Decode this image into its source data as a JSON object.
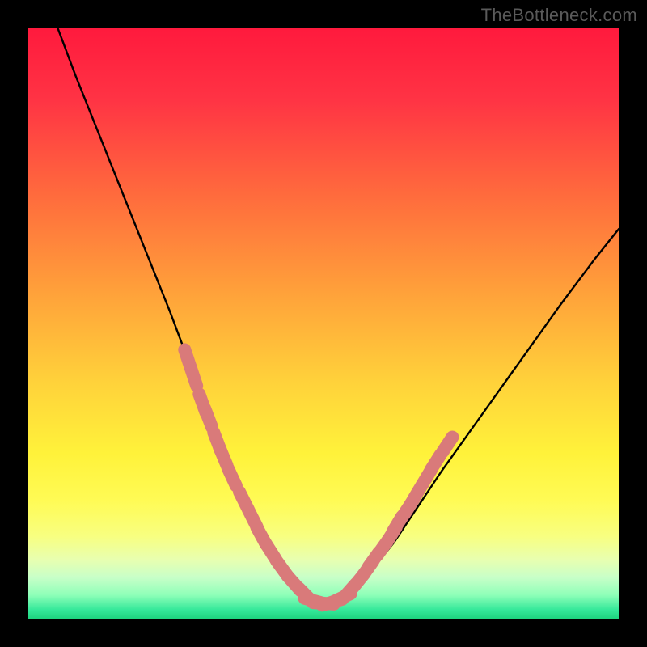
{
  "watermark": "TheBottleneck.com",
  "colors": {
    "frame_bg": "#000000",
    "curve_stroke": "#000000",
    "bead_fill": "#d97a7a",
    "gradient_stops": [
      {
        "offset": 0.0,
        "color": "#ff1a3d"
      },
      {
        "offset": 0.12,
        "color": "#ff3344"
      },
      {
        "offset": 0.28,
        "color": "#ff6a3d"
      },
      {
        "offset": 0.45,
        "color": "#ffa23a"
      },
      {
        "offset": 0.6,
        "color": "#ffd23a"
      },
      {
        "offset": 0.72,
        "color": "#fff23a"
      },
      {
        "offset": 0.8,
        "color": "#fffb55"
      },
      {
        "offset": 0.86,
        "color": "#f8ff80"
      },
      {
        "offset": 0.9,
        "color": "#e8ffb0"
      },
      {
        "offset": 0.93,
        "color": "#c8ffc8"
      },
      {
        "offset": 0.96,
        "color": "#8effb8"
      },
      {
        "offset": 0.985,
        "color": "#35e89a"
      },
      {
        "offset": 1.0,
        "color": "#1ed47f"
      }
    ]
  },
  "chart_data": {
    "type": "line",
    "title": "",
    "xlabel": "",
    "ylabel": "",
    "xlim": [
      0,
      100
    ],
    "ylim": [
      0,
      100
    ],
    "series": [
      {
        "name": "curve",
        "x": [
          5,
          8,
          12,
          16,
          20,
          24,
          27,
          29,
          31,
          33,
          34.5,
          36,
          37.5,
          39,
          40.5,
          42,
          44,
          46,
          48,
          49.5,
          52,
          55,
          58,
          62,
          66,
          70,
          75,
          80,
          85,
          90,
          96,
          100
        ],
        "y": [
          100,
          92,
          82,
          72,
          62,
          52,
          44,
          38,
          33,
          28,
          24,
          21,
          18,
          15,
          12,
          10,
          7,
          4.5,
          3,
          2.5,
          3,
          5,
          8,
          13,
          19,
          25,
          32,
          39,
          46,
          53,
          61,
          66
        ]
      }
    ],
    "highlight_points_left": [
      {
        "x": 27.0,
        "y": 44.0
      },
      {
        "x": 28.0,
        "y": 41.0
      },
      {
        "x": 29.5,
        "y": 36.5
      },
      {
        "x": 30.5,
        "y": 34.0
      },
      {
        "x": 32.0,
        "y": 30.0
      },
      {
        "x": 33.0,
        "y": 27.5
      },
      {
        "x": 34.5,
        "y": 24.0
      },
      {
        "x": 36.5,
        "y": 20.0
      },
      {
        "x": 38.0,
        "y": 17.0
      },
      {
        "x": 39.5,
        "y": 14.0
      },
      {
        "x": 41.0,
        "y": 11.5
      },
      {
        "x": 43.0,
        "y": 8.5
      },
      {
        "x": 45.0,
        "y": 6.0
      },
      {
        "x": 47.0,
        "y": 4.0
      }
    ],
    "highlight_points_bottom": [
      {
        "x": 48.5,
        "y": 3.0
      },
      {
        "x": 50.0,
        "y": 2.6
      },
      {
        "x": 51.5,
        "y": 2.8
      },
      {
        "x": 53.0,
        "y": 3.5
      }
    ],
    "highlight_points_right": [
      {
        "x": 54.5,
        "y": 4.8
      },
      {
        "x": 56.0,
        "y": 6.5
      },
      {
        "x": 57.5,
        "y": 8.5
      },
      {
        "x": 58.5,
        "y": 10.0
      },
      {
        "x": 60.0,
        "y": 12.0
      },
      {
        "x": 61.5,
        "y": 14.2
      },
      {
        "x": 62.5,
        "y": 16.0
      },
      {
        "x": 63.5,
        "y": 17.5
      },
      {
        "x": 64.5,
        "y": 19.0
      },
      {
        "x": 66.0,
        "y": 21.5
      },
      {
        "x": 67.5,
        "y": 24.0
      },
      {
        "x": 69.0,
        "y": 26.5
      },
      {
        "x": 71.0,
        "y": 29.5
      }
    ]
  }
}
